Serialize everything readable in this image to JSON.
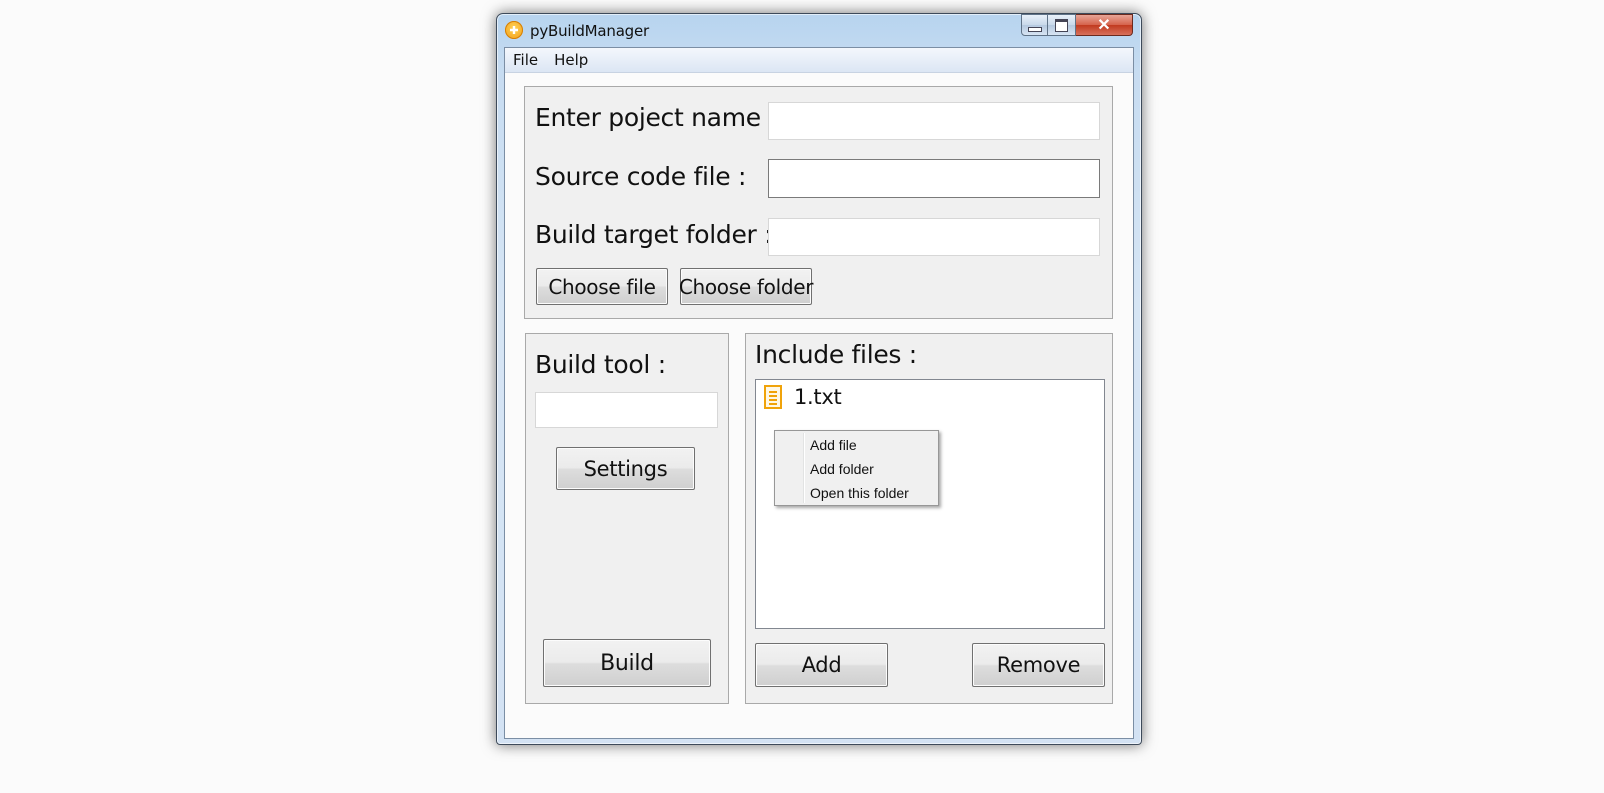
{
  "window": {
    "title": "pyBuildManager",
    "close_glyph": "✕"
  },
  "menubar": {
    "items": [
      "File",
      "Help"
    ]
  },
  "project": {
    "name_label": "Enter poject name :",
    "name_value": "",
    "source_label": "Source code file :",
    "source_value": "",
    "target_label": "Build target folder :",
    "target_value": "",
    "choose_file_label": "Choose file",
    "choose_folder_label": "Choose folder"
  },
  "build": {
    "tool_label": "Build tool :",
    "tool_value": "",
    "settings_label": "Settings",
    "build_label": "Build"
  },
  "include": {
    "label": "Include files :",
    "files": [
      {
        "name": "1.txt",
        "icon": "text-file-icon"
      }
    ],
    "add_label": "Add",
    "remove_label": "Remove"
  },
  "context_menu": {
    "items": [
      "Add file",
      "Add folder",
      "Open this folder"
    ]
  },
  "colors": {
    "file_icon": "#f0a30a",
    "close_button": "#c13a1f"
  }
}
